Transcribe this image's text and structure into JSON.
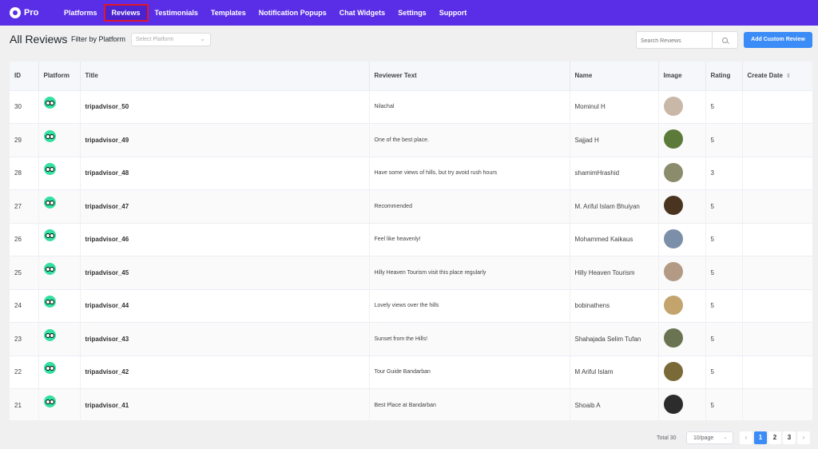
{
  "brand": {
    "name": "Pro"
  },
  "nav": [
    {
      "label": "Platforms"
    },
    {
      "label": "Reviews"
    },
    {
      "label": "Testimonials"
    },
    {
      "label": "Templates"
    },
    {
      "label": "Notification Popups"
    },
    {
      "label": "Chat Widgets"
    },
    {
      "label": "Settings"
    },
    {
      "label": "Support"
    }
  ],
  "active_nav": "Reviews",
  "header": {
    "title": "All Reviews",
    "filter_label": "Filter by Platform",
    "filter_placeholder": "Select Platform",
    "search_placeholder": "Search Reviews",
    "add_button": "Add Custom Review"
  },
  "table": {
    "columns": [
      "ID",
      "Platform",
      "Title",
      "Reviewer Text",
      "Name",
      "Image",
      "Rating",
      "Create Date"
    ],
    "rows": [
      {
        "id": "30",
        "title": "tripadvisor_50",
        "text": "Nilachal",
        "name": "Mominul H",
        "rating": "5",
        "avatar_color": "#c9b8a8"
      },
      {
        "id": "29",
        "title": "tripadvisor_49",
        "text": "One of the best place.",
        "name": "Sajjad H",
        "rating": "5",
        "avatar_color": "#5c7a3a"
      },
      {
        "id": "28",
        "title": "tripadvisor_48",
        "text": "Have some views of hills, but try avoid rush hours",
        "name": "shamimHrashid",
        "rating": "3",
        "avatar_color": "#8a8c6c"
      },
      {
        "id": "27",
        "title": "tripadvisor_47",
        "text": "Recommended",
        "name": "M. Ariful Islam Bhuiyan",
        "rating": "5",
        "avatar_color": "#4a3420"
      },
      {
        "id": "26",
        "title": "tripadvisor_46",
        "text": "Feel like heavenly!",
        "name": "Mohammed Kaikaus",
        "rating": "5",
        "avatar_color": "#7b8fa8"
      },
      {
        "id": "25",
        "title": "tripadvisor_45",
        "text": "Hilly Heaven Tourism visit this place regularly",
        "name": "Hilly Heaven Tourism",
        "rating": "5",
        "avatar_color": "#b29a84"
      },
      {
        "id": "24",
        "title": "tripadvisor_44",
        "text": "Lovely views over the hills",
        "name": "bobinathens",
        "rating": "5",
        "avatar_color": "#c2a46c"
      },
      {
        "id": "23",
        "title": "tripadvisor_43",
        "text": "Sunset from the Hills!",
        "name": "Shahajada Selim Tufan",
        "rating": "5",
        "avatar_color": "#6a7452"
      },
      {
        "id": "22",
        "title": "tripadvisor_42",
        "text": "Tour Guide Bandarban",
        "name": "M Ariful Islam",
        "rating": "5",
        "avatar_color": "#7a6a38"
      },
      {
        "id": "21",
        "title": "tripadvisor_41",
        "text": "Best Place at Bandarban",
        "name": "Shoaib A",
        "rating": "5",
        "avatar_color": "#2c2c2c"
      }
    ]
  },
  "pagination": {
    "total": "Total 30",
    "page_size": "10/page",
    "prev": "‹",
    "pages": [
      "1",
      "2",
      "3"
    ],
    "current": "1",
    "next": "›"
  },
  "colors": {
    "nav_bg": "#5a2ee6",
    "accent": "#3b8cf6",
    "tripadvisor": "#34e0a1",
    "active_outline": "#e0162b"
  },
  "icons": {
    "platform": "tripadvisor-icon",
    "search": "search-icon",
    "sort": "sort-icon",
    "dropdown": "chevron-down-icon"
  }
}
